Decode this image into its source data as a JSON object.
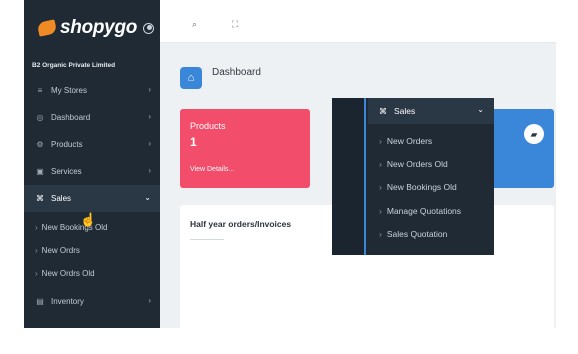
{
  "brand": {
    "name": "shopygo"
  },
  "company": "B2 Organic Private Limited",
  "sidebar": {
    "items": [
      {
        "label": "My Stores",
        "icon": "list-icon"
      },
      {
        "label": "Dashboard",
        "icon": "dashboard-icon"
      },
      {
        "label": "Products",
        "icon": "products-icon"
      },
      {
        "label": "Services",
        "icon": "services-icon"
      },
      {
        "label": "Sales",
        "icon": "command-icon",
        "active": true
      }
    ],
    "sales_sub": [
      "New Bookings Old",
      "New Ordrs",
      "New Ordrs Old"
    ],
    "bottom": {
      "label": "Inventory",
      "icon": "inventory-icon"
    }
  },
  "page": {
    "title": "Dashboard"
  },
  "cards": {
    "products": {
      "title": "Products",
      "value": "1",
      "link": "View Details..."
    }
  },
  "panel": {
    "title": "Half year orders/Invoices"
  },
  "flyout": {
    "header": "Sales",
    "items": [
      "New Orders",
      "New Orders Old",
      "New Bookings Old",
      "Manage Quotations",
      "Sales Quotation"
    ]
  },
  "colors": {
    "sidebar_bg": "#1f2a35",
    "card_red": "#f24d6b",
    "card_blue": "#3a86d9",
    "accent_orange": "#f08a24"
  }
}
